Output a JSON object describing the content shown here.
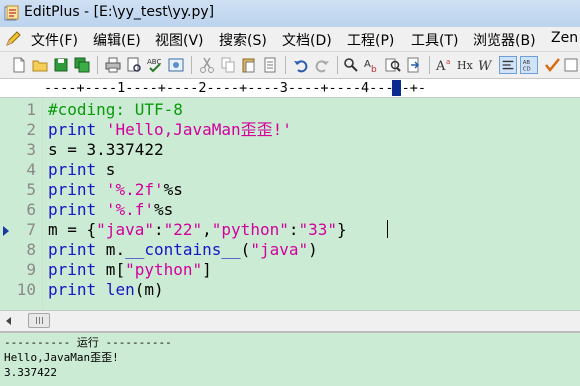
{
  "window": {
    "title": "EditPlus - [E:\\yy_test\\yy.py]"
  },
  "menu": {
    "items": [
      "文件(F)",
      "编辑(E)",
      "视图(V)",
      "搜索(S)",
      "文档(D)",
      "工程(P)",
      "工具(T)",
      "浏览器(B)",
      "Zen"
    ]
  },
  "toolbar": {
    "icons": [
      "new-file-icon",
      "open-folder-icon",
      "save-icon",
      "save-all-icon",
      "print-icon",
      "print-preview-icon",
      "spell-check-icon",
      "browser-view-icon",
      "cut-icon",
      "copy-icon",
      "paste-icon",
      "delete-icon",
      "undo-icon",
      "redo-icon",
      "find-icon",
      "replace-icon",
      "find-in-files-icon",
      "goto-icon",
      "font-size-icon",
      "hex-icon",
      "italic-w-icon",
      "word-wrap-icon",
      "column-select-icon",
      "check-icon"
    ]
  },
  "ruler": {
    "text": "----+----1----+----2----+----3----+----4-----+-"
  },
  "editor": {
    "line_numbers": [
      "1",
      "2",
      "3",
      "4",
      "5",
      "6",
      "7",
      "8",
      "9",
      "10"
    ],
    "current_line": 7,
    "lines": [
      [
        {
          "t": "cmt",
          "v": "#coding: UTF-8"
        }
      ],
      [
        {
          "t": "kw",
          "v": "print"
        },
        {
          "t": "txt",
          "v": " "
        },
        {
          "t": "str",
          "v": "'Hello,JavaMan歪歪!'"
        }
      ],
      [
        {
          "t": "txt",
          "v": "s = 3.337422"
        }
      ],
      [
        {
          "t": "kw",
          "v": "print"
        },
        {
          "t": "txt",
          "v": " s"
        }
      ],
      [
        {
          "t": "kw",
          "v": "print"
        },
        {
          "t": "txt",
          "v": " "
        },
        {
          "t": "str",
          "v": "'%.2f'"
        },
        {
          "t": "txt",
          "v": "%s"
        }
      ],
      [
        {
          "t": "kw",
          "v": "print"
        },
        {
          "t": "txt",
          "v": " "
        },
        {
          "t": "str",
          "v": "'%.f'"
        },
        {
          "t": "txt",
          "v": "%s"
        }
      ],
      [
        {
          "t": "txt",
          "v": "m = {"
        },
        {
          "t": "str",
          "v": "\"java\""
        },
        {
          "t": "txt",
          "v": ":"
        },
        {
          "t": "str",
          "v": "\"22\""
        },
        {
          "t": "txt",
          "v": ","
        },
        {
          "t": "str",
          "v": "\"python\""
        },
        {
          "t": "txt",
          "v": ":"
        },
        {
          "t": "str",
          "v": "\"33\""
        },
        {
          "t": "txt",
          "v": "}"
        }
      ],
      [
        {
          "t": "kw",
          "v": "print"
        },
        {
          "t": "txt",
          "v": " m."
        },
        {
          "t": "kw",
          "v": "__contains__"
        },
        {
          "t": "txt",
          "v": "("
        },
        {
          "t": "str",
          "v": "\"java\""
        },
        {
          "t": "txt",
          "v": ")"
        }
      ],
      [
        {
          "t": "kw",
          "v": "print"
        },
        {
          "t": "txt",
          "v": " m["
        },
        {
          "t": "str",
          "v": "\"python\""
        },
        {
          "t": "txt",
          "v": "]"
        }
      ],
      [
        {
          "t": "kw",
          "v": "print"
        },
        {
          "t": "txt",
          "v": " "
        },
        {
          "t": "kw",
          "v": "len"
        },
        {
          "t": "txt",
          "v": "(m)"
        }
      ]
    ]
  },
  "output": {
    "lines": [
      "---------- 运行 ----------",
      "Hello,JavaMan歪歪!",
      "3.337422"
    ]
  },
  "colors": {
    "editor_bg": "#ccebd4",
    "keyword": "#1515c8",
    "string": "#d2009d",
    "comment": "#0a9a0a"
  }
}
